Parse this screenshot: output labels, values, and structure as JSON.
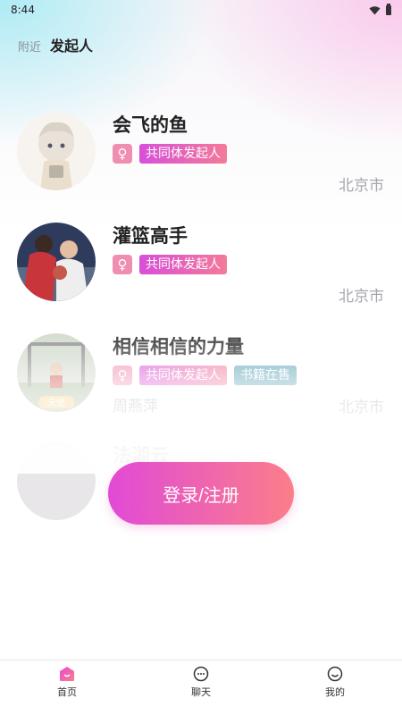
{
  "status_bar": {
    "time": "8:44"
  },
  "top_tabs": {
    "nearby": "附近",
    "initiator": "发起人"
  },
  "users": [
    {
      "name": "会飞的鱼",
      "gender": "♀",
      "tags": [
        "共同体发起人"
      ],
      "city": "北京市",
      "subtitle": ""
    },
    {
      "name": "灌篮高手",
      "gender": "♀",
      "tags": [
        "共同体发起人"
      ],
      "city": "北京市",
      "subtitle": ""
    },
    {
      "name": "相信相信的力量",
      "gender": "♀",
      "tags": [
        "共同体发起人",
        "书籍在售"
      ],
      "city": "北京市",
      "subtitle": "周燕萍"
    },
    {
      "name": "法湘云"
    }
  ],
  "avatar_badge": "天使",
  "login_button": "登录/注册",
  "bottom_nav": {
    "home": "首页",
    "chat": "聊天",
    "mine": "我的"
  },
  "colors": {
    "accent_start": "#e14ad6",
    "accent_end": "#fb7e8a",
    "book_tag": "#5aa3b4",
    "gender_female": "#f08eb1"
  }
}
